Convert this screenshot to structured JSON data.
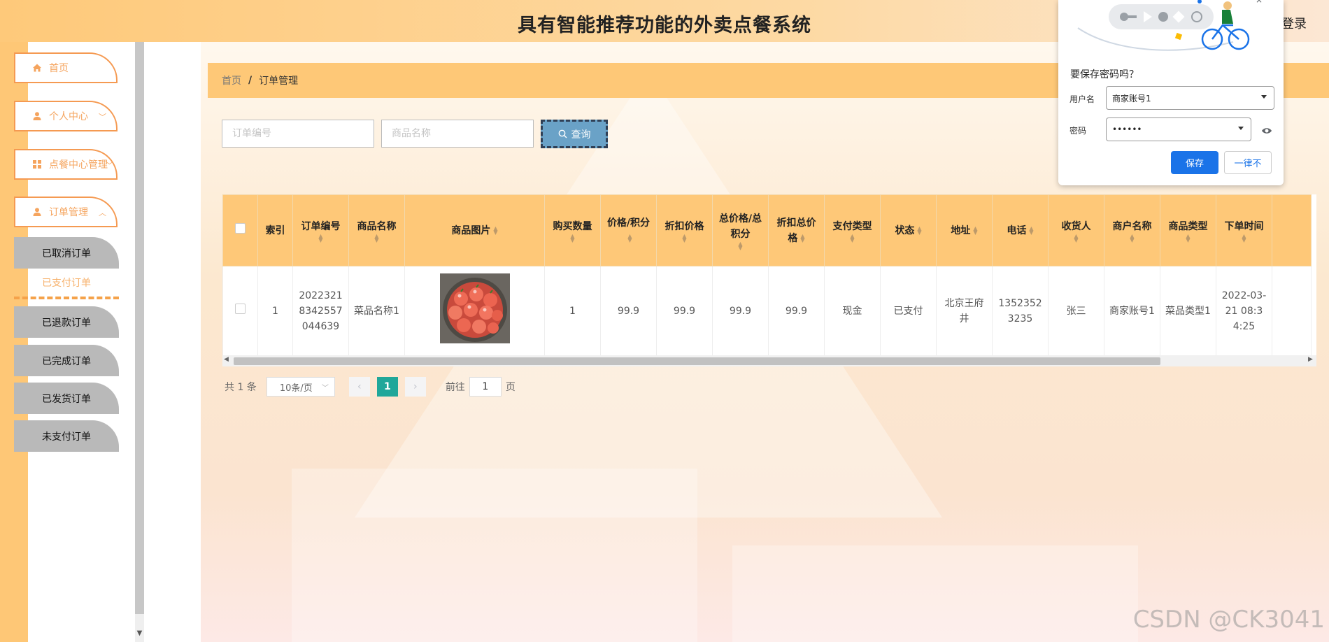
{
  "app": {
    "title": "具有智能推荐功能的外卖点餐系统",
    "login": "登录"
  },
  "sidebar": {
    "items": [
      {
        "label": "首页"
      },
      {
        "label": "个人中心"
      },
      {
        "label": "点餐中心管理"
      },
      {
        "label": "订单管理"
      }
    ],
    "submenu": [
      {
        "label": "已取消订单"
      },
      {
        "label": "已支付订单"
      },
      {
        "label": "已退款订单"
      },
      {
        "label": "已完成订单"
      },
      {
        "label": "已发货订单"
      },
      {
        "label": "未支付订单"
      }
    ],
    "active_submenu": "已支付订单"
  },
  "breadcrumb": {
    "home": "首页",
    "separator": "/",
    "current": "订单管理"
  },
  "search": {
    "order_no_placeholder": "订单编号",
    "product_name_placeholder": "商品名称",
    "button": "查询"
  },
  "table": {
    "columns": [
      "索引",
      "订单编号",
      "商品名称",
      "商品图片",
      "购买数量",
      "价格/积分",
      "折扣价格",
      "总价格/总积分",
      "折扣总价格",
      "支付类型",
      "状态",
      "地址",
      "电话",
      "收货人",
      "商户名称",
      "商品类型",
      "下单时间"
    ],
    "rows": [
      {
        "index": "1",
        "order_no": "20223218342557044639",
        "product_name": "菜品名称1",
        "quantity": "1",
        "price": "99.9",
        "discount_price": "99.9",
        "total_price": "99.9",
        "discount_total": "99.9",
        "pay_type": "现金",
        "status": "已支付",
        "address": "北京王府井",
        "phone": "13523523235",
        "receiver": "张三",
        "merchant": "商家账号1",
        "product_type": "菜品类型1",
        "order_time": "2022-03-21 08:34:25"
      }
    ]
  },
  "pagination": {
    "total": "共 1 条",
    "page_size": "10条/页",
    "current_page": "1",
    "goto_label": "前往",
    "goto_value": "1",
    "page_suffix": "页"
  },
  "password_popup": {
    "title": "要保存密码吗？",
    "username_label": "用户名",
    "username_value": "商家账号1",
    "password_label": "密码",
    "password_value": "••••••",
    "save_label": "保存",
    "never_label": "一律不"
  },
  "watermark": "CSDN @CK3041",
  "colors": {
    "accent": "#fec877",
    "menu_border": "#f59a52",
    "pager_active": "#20a79a",
    "search_button": "#6aa2c7",
    "popup_primary": "#1a73e8"
  }
}
